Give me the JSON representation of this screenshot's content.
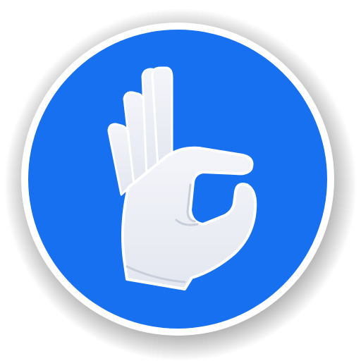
{
  "icon": {
    "name": "ok-hand-gesture-icon",
    "colors": {
      "background": "#ffffff",
      "ring": "#ffffff",
      "disc": "#1670f0",
      "hand_fill": "#eef0f7",
      "hand_outline": "#ffffff",
      "hand_shadow": "#c9cedb"
    }
  }
}
